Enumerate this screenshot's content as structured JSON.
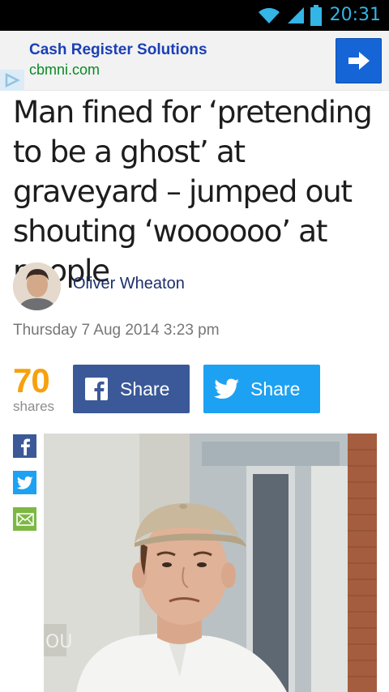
{
  "status_bar": {
    "time": "20:31",
    "icons": [
      "wifi-icon",
      "signal-icon",
      "battery-icon"
    ],
    "accent_color": "#33b5e5"
  },
  "ad": {
    "title": "Cash Register Solutions",
    "url": "cbmni.com",
    "button_icon": "arrow-right-icon",
    "title_color": "#1a3fb5",
    "url_color": "#0a8a28",
    "button_color": "#1565d6"
  },
  "article": {
    "headline": "Man fined for ‘pretending to be a ghost’ at graveyard – jumped out shouting ‘woooooo’ at people",
    "author": "Oliver Wheaton",
    "date": "Thursday 7 Aug 2014 3:23 pm",
    "share_count": "70",
    "share_count_label": "shares",
    "share_count_color": "#f6a10f"
  },
  "share_buttons": {
    "facebook_label": "Share",
    "twitter_label": "Share",
    "facebook_color": "#3b5998",
    "twitter_color": "#1da1f2"
  },
  "side_share": {
    "icons": [
      "facebook-icon",
      "twitter-icon",
      "mail-icon"
    ],
    "mail_color": "#7db843"
  },
  "photo": {
    "wall_text": "OU"
  }
}
